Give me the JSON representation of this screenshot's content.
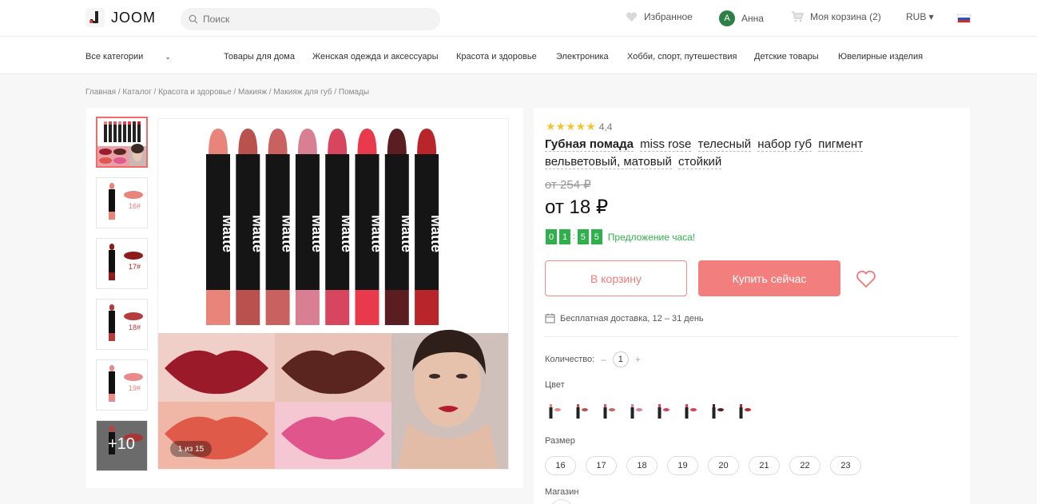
{
  "header": {
    "logo": "JOOM",
    "search_placeholder": "Поиск",
    "favorites": "Избранное",
    "user_initial": "A",
    "user_name": "Анна",
    "cart": "Моя корзина (2)",
    "currency": "RUB ▾"
  },
  "categories": {
    "all": "Все категории",
    "items": [
      "Товары для дома",
      "Женская одежда и аксессуары",
      "Красота и здоровье",
      "Электроника",
      "Хобби, спорт, путешествия",
      "Детские товары",
      "Ювелирные изделия"
    ]
  },
  "breadcrumb": "Главная / Каталог / Красота и здоровье / Макияж / Макияж для губ / Помады",
  "gallery": {
    "thumb_labels": [
      "16#",
      "17#",
      "18#",
      "19#"
    ],
    "more_label": "+10",
    "counter": "1 из 15",
    "lipstick_colors": [
      "#e8847a",
      "#b9514f",
      "#c86160",
      "#d97f93",
      "#d8455f",
      "#e83a4c",
      "#5a1e22",
      "#b8262b"
    ],
    "lipstick_text": "Matte"
  },
  "product": {
    "stars": "★★★★★",
    "rating": "4,4",
    "title_first": "Губная помада",
    "title_tags": [
      "miss rose",
      "телесный",
      "набор губ",
      "пигмент",
      "вельветовый, матовый",
      "стойкий"
    ],
    "old_price": "от 254 ₽",
    "price": "от 18 ₽",
    "timer_digits": [
      "0",
      "1",
      "5",
      "5"
    ],
    "timer_offer": "Предложение часа!",
    "btn_cart": "В корзину",
    "btn_buy": "Купить сейчас",
    "delivery": "Бесплатная доставка, 12 – 31 день",
    "qty_label": "Количество:",
    "qty_minus": "–",
    "qty_value": "1",
    "qty_plus": "+",
    "color_label": "Цвет",
    "size_label": "Размер",
    "sizes": [
      "16",
      "17",
      "18",
      "19",
      "20",
      "21",
      "22",
      "23"
    ],
    "store_label": "Магазин"
  },
  "colors": {
    "accent": "#f37e7e",
    "timer_green": "#2fb04d",
    "star": "#f4c430"
  }
}
